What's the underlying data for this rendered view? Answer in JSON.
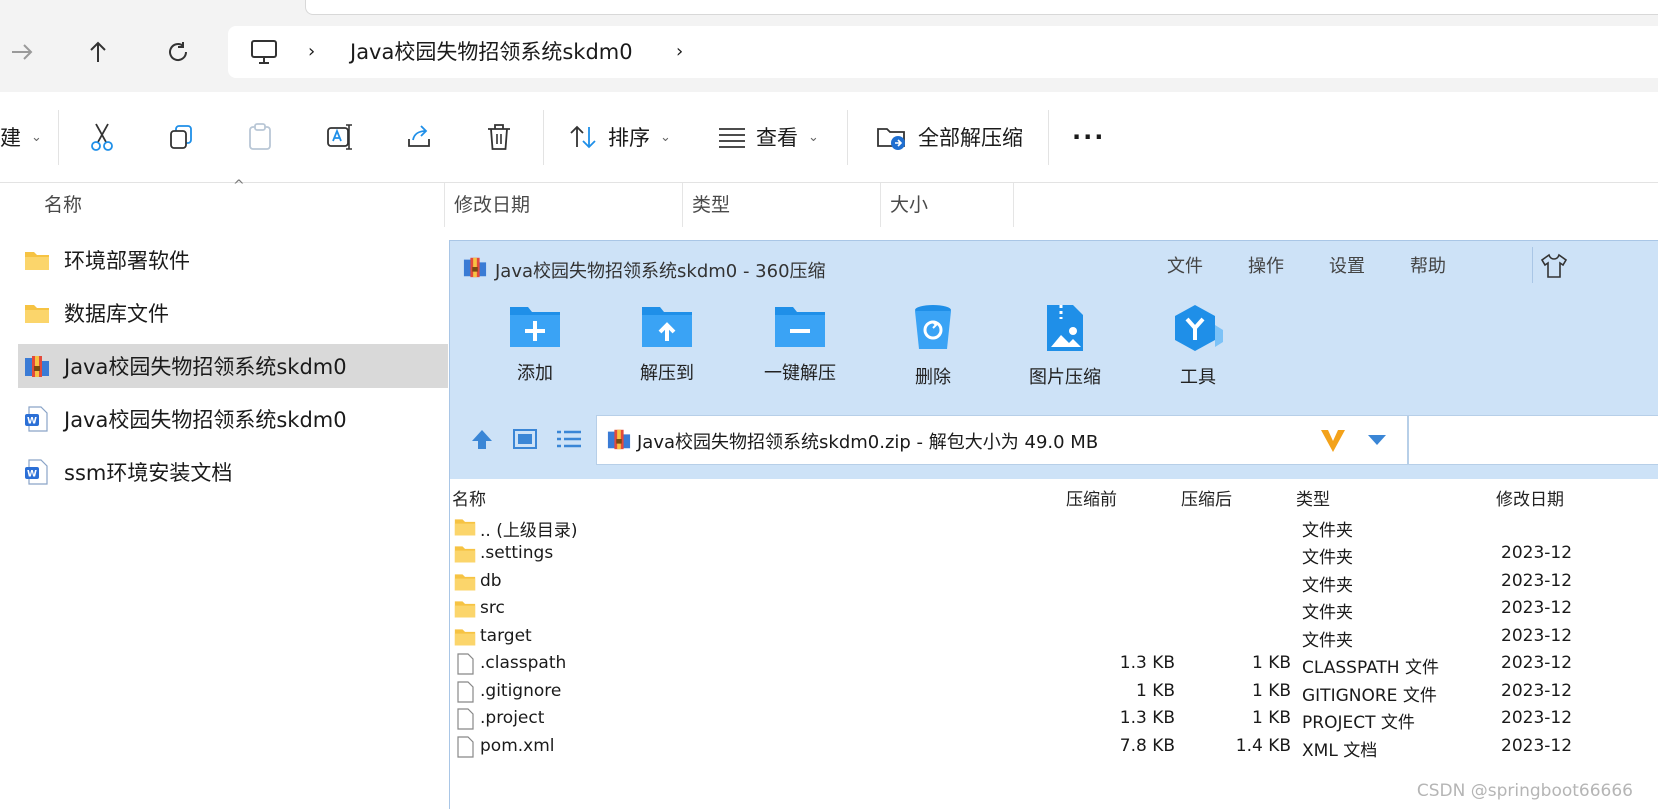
{
  "explorer": {
    "breadcrumb": [
      "Java校园失物招领系统skdm0"
    ],
    "toolbar": {
      "new_partial": "建",
      "sort_label": "排序",
      "view_label": "查看",
      "extract_all_label": "全部解压缩",
      "more_label": "···"
    },
    "columns": [
      "名称",
      "修改日期",
      "类型",
      "大小"
    ],
    "items": [
      {
        "name": "环境部署软件",
        "icon": "folder-icon"
      },
      {
        "name": "数据库文件",
        "icon": "folder-icon"
      },
      {
        "name": "Java校园失物招领系统skdm0",
        "icon": "zip-archive-icon",
        "selected": true
      },
      {
        "name": "Java校园失物招领系统skdm0",
        "icon": "word-doc-icon"
      },
      {
        "name": "ssm环境安装文档",
        "icon": "word-doc-icon"
      }
    ]
  },
  "zip": {
    "title": "Java校园失物招领系统skdm0 - 360压缩",
    "menu": [
      "文件",
      "操作",
      "设置",
      "帮助"
    ],
    "actions": [
      "添加",
      "解压到",
      "一键解压",
      "删除",
      "图片压缩",
      "工具"
    ],
    "path": "Java校园失物招领系统skdm0.zip - 解包大小为 49.0 MB",
    "columns": [
      "名称",
      "压缩前",
      "压缩后",
      "类型",
      "修改日期"
    ],
    "rows": [
      {
        "name": ".. (上级目录)",
        "before": "",
        "after": "",
        "type": "文件夹",
        "date": "",
        "kind": "folder"
      },
      {
        "name": ".settings",
        "before": "",
        "after": "",
        "type": "文件夹",
        "date": "2023-12",
        "kind": "folder"
      },
      {
        "name": "db",
        "before": "",
        "after": "",
        "type": "文件夹",
        "date": "2023-12",
        "kind": "folder"
      },
      {
        "name": "src",
        "before": "",
        "after": "",
        "type": "文件夹",
        "date": "2023-12",
        "kind": "folder"
      },
      {
        "name": "target",
        "before": "",
        "after": "",
        "type": "文件夹",
        "date": "2023-12",
        "kind": "folder"
      },
      {
        "name": ".classpath",
        "before": "1.3 KB",
        "after": "1 KB",
        "type": "CLASSPATH 文件",
        "date": "2023-12",
        "kind": "file"
      },
      {
        "name": ".gitignore",
        "before": "1 KB",
        "after": "1 KB",
        "type": "GITIGNORE 文件",
        "date": "2023-12",
        "kind": "file"
      },
      {
        "name": ".project",
        "before": "1.3 KB",
        "after": "1 KB",
        "type": "PROJECT 文件",
        "date": "2023-12",
        "kind": "file"
      },
      {
        "name": "pom.xml",
        "before": "7.8 KB",
        "after": "1.4 KB",
        "type": "XML 文档",
        "date": "2023-12",
        "kind": "file"
      }
    ],
    "watermark": "CSDN @springboot66666"
  },
  "colors": {
    "zip_bg": "#cde2f7",
    "accent_blue": "#1f8fe8",
    "folder_yellow": "#f6c343",
    "selected_row": "#d9d9d9"
  }
}
